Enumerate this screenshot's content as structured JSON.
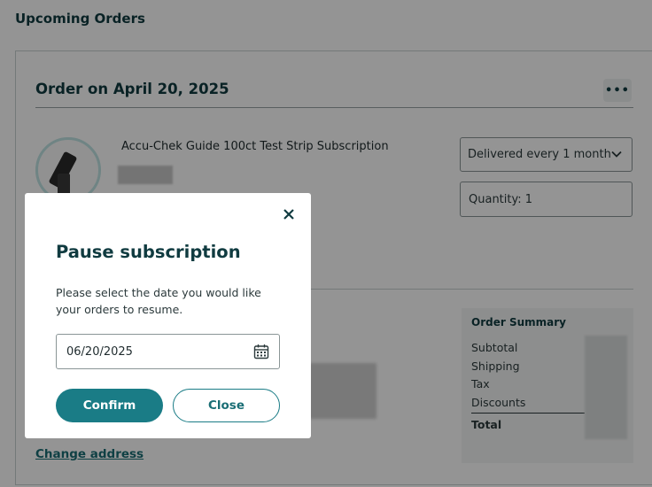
{
  "page": {
    "title": "Upcoming Orders"
  },
  "order": {
    "title": "Order on April 20, 2025",
    "more_label": "•••",
    "product_name": "Accu-Chek Guide 100ct Test Strip Subscription",
    "frequency_value": "Delivered every 1 month",
    "quantity_label": "Quantity: 1",
    "change_address_label": "Change address"
  },
  "summary": {
    "title": "Order Summary",
    "rows": [
      "Subtotal",
      "Shipping",
      "Tax",
      "Discounts"
    ],
    "total_label": "Total"
  },
  "modal": {
    "title": "Pause subscription",
    "description": "Please select the date you would like your orders to resume.",
    "date_value": "06/20/2025",
    "confirm_label": "Confirm",
    "close_label": "Close"
  },
  "colors": {
    "accent": "#1a7c86",
    "heading": "#103b40",
    "overlay": "rgba(0,0,0,0.42)"
  },
  "icons": {
    "more": "ellipsis-icon",
    "frequency_chevron": "chevron-down-icon",
    "modal_close": "close-icon",
    "date_picker": "calendar-icon"
  }
}
